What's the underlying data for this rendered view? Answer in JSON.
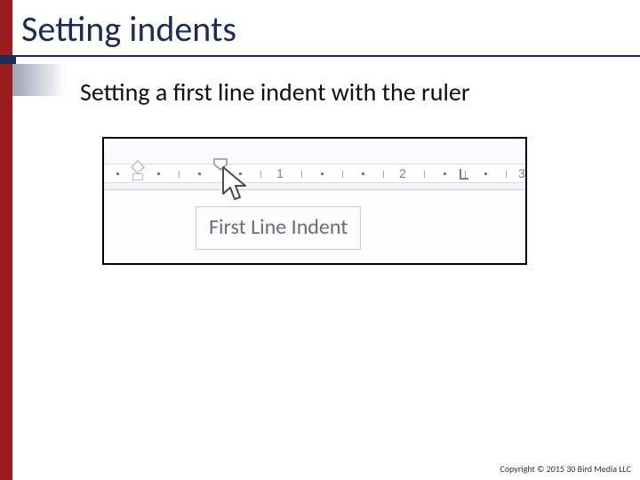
{
  "title": "Setting indents",
  "subtitle": "Setting a first line indent with the ruler",
  "ruler": {
    "numbers": [
      "1",
      "2",
      "3"
    ]
  },
  "tooltip": "First Line Indent",
  "copyright": "Copyright © 2015 30 Bird Media LLC"
}
